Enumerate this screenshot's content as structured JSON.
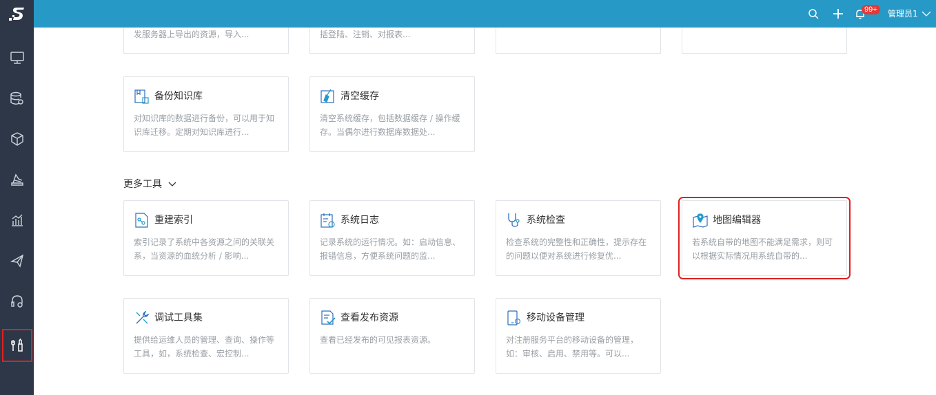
{
  "topbar": {
    "badge": "99+",
    "user": "管理员1",
    "icons": [
      "search-icon",
      "plus-icon",
      "bell-icon",
      "chevron-down-icon"
    ],
    "color": "#2699c7"
  },
  "sidebar": {
    "logo_letter": "S",
    "items": [
      {
        "icon": "monitor-icon"
      },
      {
        "icon": "database-settings-icon"
      },
      {
        "icon": "cube-icon"
      },
      {
        "icon": "layers-icon"
      },
      {
        "icon": "bar-chart-icon"
      },
      {
        "icon": "send-icon"
      },
      {
        "icon": "headset-icon"
      },
      {
        "icon": "tools-icon",
        "active": true
      }
    ],
    "color": "#2d3747"
  },
  "top_cards": [
    {
      "desc": "发服务器上导出的资源，导入..."
    },
    {
      "desc": "括登陆、注销、对报表..."
    },
    {
      "desc": ""
    },
    {
      "desc": ""
    }
  ],
  "cards_row2": [
    {
      "title": "备份知识库",
      "desc": "对知识库的数据进行备份，可以用于知识库迁移。定期对知识库进行...",
      "icon": "backup-icon"
    },
    {
      "title": "清空缓存",
      "desc": "清空系统缓存，包括数据缓存 / 操作缓存。当偶尔进行数据库数据处...",
      "icon": "broom-icon"
    }
  ],
  "more_tools": {
    "title": "更多工具",
    "cards": [
      {
        "title": "重建索引",
        "desc": "索引记录了系统中各资源之间的关联关系，当资源的血统分析 / 影响...",
        "icon": "index-icon"
      },
      {
        "title": "系统日志",
        "desc": "记录系统的运行情况。如：启动信息、报错信息，方便系统问题的监...",
        "icon": "log-icon"
      },
      {
        "title": "系统检查",
        "desc": "检查系统的完整性和正确性，提示存在的问题以便对系统进行修复优...",
        "icon": "stethoscope-icon"
      },
      {
        "title": "地图编辑器",
        "desc": "若系统自带的地图不能满足需求，则可以根据实际情况用系统自带的...",
        "icon": "map-pin-icon"
      },
      {
        "title": "调试工具集",
        "desc": "提供给运维人员的管理、查询、操作等工具，如，系统检查、宏控制...",
        "icon": "wrench-icon"
      },
      {
        "title": "查看发布资源",
        "desc": "查看已经发布的可见报表资源。",
        "icon": "document-check-icon"
      },
      {
        "title": "移动设备管理",
        "desc": "对注册服务平台的移动设备的管理，如：审核、启用、禁用等。可以...",
        "icon": "mobile-settings-icon"
      }
    ]
  }
}
